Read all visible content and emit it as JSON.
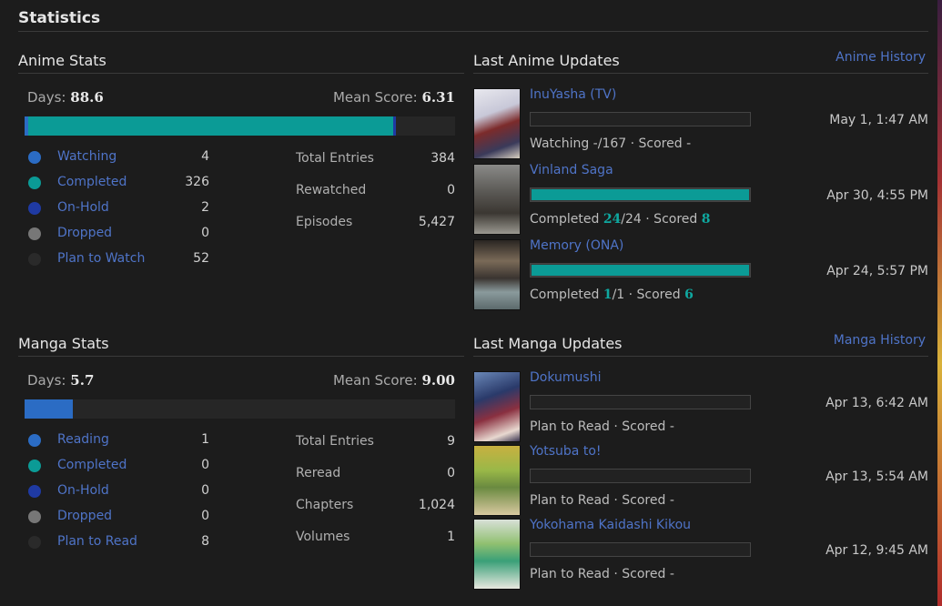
{
  "title": "Statistics",
  "anime": {
    "heading": "Anime Stats",
    "days_label": "Days:",
    "days_value": "88.6",
    "mean_label": "Mean Score:",
    "mean_value": "6.31",
    "bar_fractions": {
      "watching": 0.008,
      "completed": 0.849,
      "onhold": 0.005,
      "dropped": 0,
      "plan": 0.135
    },
    "status": [
      {
        "label": "Watching",
        "value": "4",
        "color": "#2b6cc4"
      },
      {
        "label": "Completed",
        "value": "326",
        "color": "#0b9b96"
      },
      {
        "label": "On-Hold",
        "value": "2",
        "color": "#1f3aa3"
      },
      {
        "label": "Dropped",
        "value": "0",
        "color": "#777777"
      },
      {
        "label": "Plan to Watch",
        "value": "52",
        "color": "#2a2a2a"
      }
    ],
    "totals": [
      {
        "label": "Total Entries",
        "value": "384"
      },
      {
        "label": "Rewatched",
        "value": "0"
      },
      {
        "label": "Episodes",
        "value": "5,427"
      }
    ]
  },
  "manga": {
    "heading": "Manga Stats",
    "days_label": "Days:",
    "days_value": "5.7",
    "mean_label": "Mean Score:",
    "mean_value": "9.00",
    "bar_fractions": {
      "reading": 0.111,
      "completed": 0,
      "onhold": 0,
      "dropped": 0,
      "plan": 0.889
    },
    "status": [
      {
        "label": "Reading",
        "value": "1",
        "color": "#2b6cc4"
      },
      {
        "label": "Completed",
        "value": "0",
        "color": "#0b9b96"
      },
      {
        "label": "On-Hold",
        "value": "0",
        "color": "#1f3aa3"
      },
      {
        "label": "Dropped",
        "value": "0",
        "color": "#777777"
      },
      {
        "label": "Plan to Read",
        "value": "8",
        "color": "#2a2a2a"
      }
    ],
    "totals": [
      {
        "label": "Total Entries",
        "value": "9"
      },
      {
        "label": "Reread",
        "value": "0"
      },
      {
        "label": "Chapters",
        "value": "1,024"
      },
      {
        "label": "Volumes",
        "value": "1"
      }
    ]
  },
  "anime_updates": {
    "heading": "Last Anime Updates",
    "history_link": "Anime History",
    "items": [
      {
        "title": "InuYasha (TV)",
        "progress": 0,
        "status_pre": "Watching -/167 · Scored -",
        "done": "",
        "total": "",
        "score": "",
        "date": "May 1, 1:47 AM"
      },
      {
        "title": "Vinland Saga",
        "progress": 1,
        "status_pre": "Completed ",
        "done": "24",
        "total": "/24 · Scored ",
        "score": "8",
        "date": "Apr 30, 4:55 PM"
      },
      {
        "title": "Memory (ONA)",
        "progress": 1,
        "status_pre": "Completed ",
        "done": "1",
        "total": "/1 · Scored ",
        "score": "6",
        "date": "Apr 24, 5:57 PM"
      }
    ]
  },
  "manga_updates": {
    "heading": "Last Manga Updates",
    "history_link": "Manga History",
    "items": [
      {
        "title": "Dokumushi",
        "progress": 0,
        "status": "Plan to Read · Scored -",
        "date": "Apr 13, 6:42 AM"
      },
      {
        "title": "Yotsuba to!",
        "progress": 0,
        "status": "Plan to Read · Scored -",
        "date": "Apr 13, 5:54 AM"
      },
      {
        "title": "Yokohama Kaidashi Kikou",
        "progress": 0,
        "status": "Plan to Read · Scored -",
        "date": "Apr 12, 9:45 AM"
      }
    ]
  }
}
